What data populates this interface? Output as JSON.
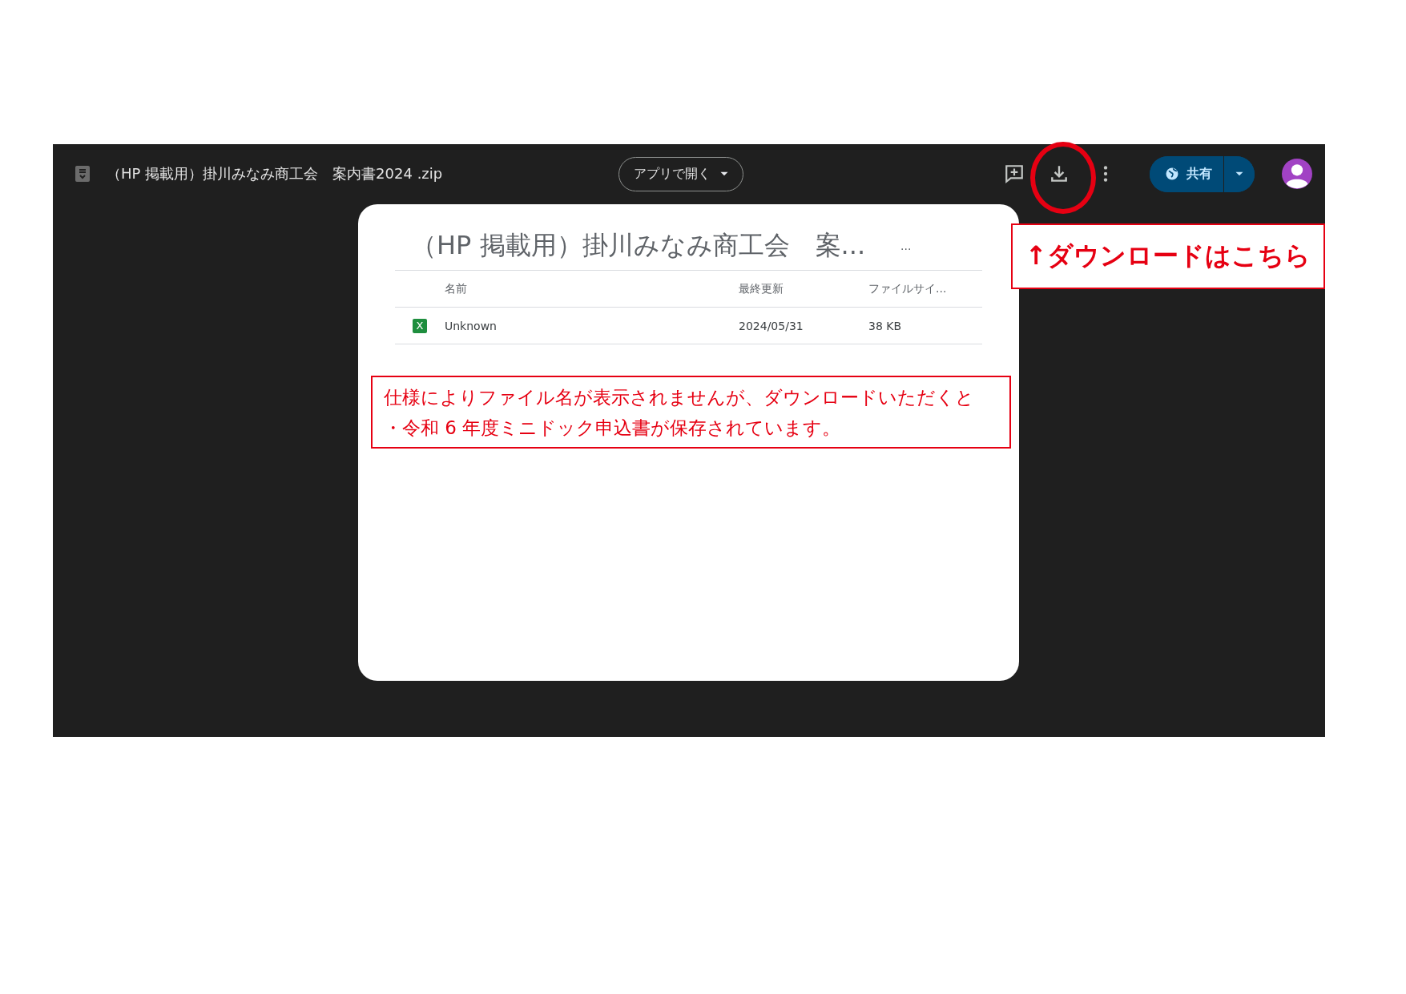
{
  "top_bar": {
    "file_title": "（HP 掲載用）掛川みなみ商工会　案内書2024 .zip",
    "open_with_button": "アプリで開く",
    "share_button": "共有"
  },
  "preview": {
    "title": "（HP 掲載用）掛川みなみ商工会　案...",
    "more": "...",
    "table": {
      "columns": [
        "名前",
        "最終更新",
        "ファイルサイ..."
      ],
      "rows": [
        {
          "kind": "excel",
          "icon_letter": "X",
          "name": "Unknown",
          "modified": "2024/05/31",
          "size": "38 KB"
        }
      ]
    }
  },
  "annotations": {
    "download_note": "↑ダウンロードはこちら",
    "filename_note": [
      "仕様によりファイル名が表示されませんが、ダウンロードいただくと",
      "・令和 6 年度ミニドック申込書が保存されています。"
    ]
  }
}
